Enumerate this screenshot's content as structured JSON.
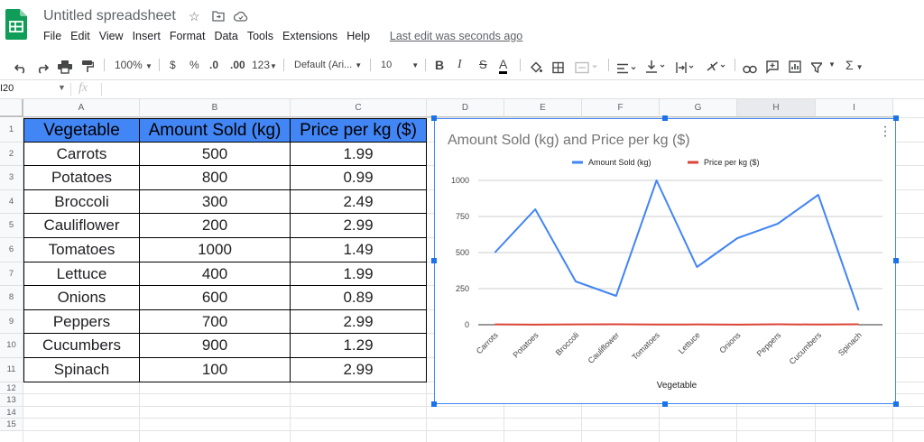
{
  "app": {
    "title": "Untitled spreadsheet",
    "icons": [
      "star-icon",
      "move-to-folder-icon",
      "cloud-status-icon"
    ]
  },
  "menu": {
    "items": [
      "File",
      "Edit",
      "View",
      "Insert",
      "Format",
      "Data",
      "Tools",
      "Extensions",
      "Help"
    ],
    "last_edit": "Last edit was seconds ago"
  },
  "toolbar": {
    "zoom": "100%",
    "currency": "$",
    "percent": "%",
    "decrease_decimal": ".0",
    "increase_decimal": ".00",
    "more_formats": "123",
    "font": "Default (Ari...",
    "font_size": "10",
    "bold": "B",
    "italic": "I",
    "strike": "S",
    "text_color": "A",
    "functions": "Σ"
  },
  "namebox": {
    "value": "I20"
  },
  "formula": {
    "icon_label": "fx",
    "value": ""
  },
  "columns": [
    "A",
    "B",
    "C",
    "D",
    "E",
    "F",
    "G",
    "H",
    "I"
  ],
  "selected_column": "H",
  "rows": [
    "1",
    "2",
    "3",
    "4",
    "5",
    "6",
    "7",
    "8",
    "9",
    "10",
    "11",
    "12",
    "13",
    "14",
    "15"
  ],
  "table": {
    "headers": [
      "Vegetable",
      "Amount Sold (kg)",
      "Price per kg ($)"
    ],
    "rows": [
      [
        "Carrots",
        "500",
        "1.99"
      ],
      [
        "Potatoes",
        "800",
        "0.99"
      ],
      [
        "Broccoli",
        "300",
        "2.49"
      ],
      [
        "Cauliflower",
        "200",
        "2.99"
      ],
      [
        "Tomatoes",
        "1000",
        "1.49"
      ],
      [
        "Lettuce",
        "400",
        "1.99"
      ],
      [
        "Onions",
        "600",
        "0.89"
      ],
      [
        "Peppers",
        "700",
        "2.99"
      ],
      [
        "Cucumbers",
        "900",
        "1.29"
      ],
      [
        "Spinach",
        "100",
        "2.99"
      ]
    ],
    "header_color": "#4285f4"
  },
  "chart_data": {
    "type": "line",
    "title": "Amount Sold (kg) and Price per kg ($)",
    "xlabel": "Vegetable",
    "ylabel": "",
    "categories": [
      "Carrots",
      "Potatoes",
      "Broccoli",
      "Cauliflower",
      "Tomatoes",
      "Lettuce",
      "Onions",
      "Peppers",
      "Cucumbers",
      "Spinach"
    ],
    "series": [
      {
        "name": "Amount Sold (kg)",
        "color": "#4285f4",
        "values": [
          500,
          800,
          300,
          200,
          1000,
          400,
          600,
          700,
          900,
          100
        ]
      },
      {
        "name": "Price per kg ($)",
        "color": "#db4437",
        "values": [
          1.99,
          0.99,
          2.49,
          2.99,
          1.49,
          1.99,
          0.89,
          2.99,
          1.29,
          2.99
        ]
      }
    ],
    "yticks": [
      "0",
      "250",
      "500",
      "750",
      "1000"
    ],
    "ylim": [
      0,
      1000
    ],
    "grid": true,
    "legend": "top"
  }
}
